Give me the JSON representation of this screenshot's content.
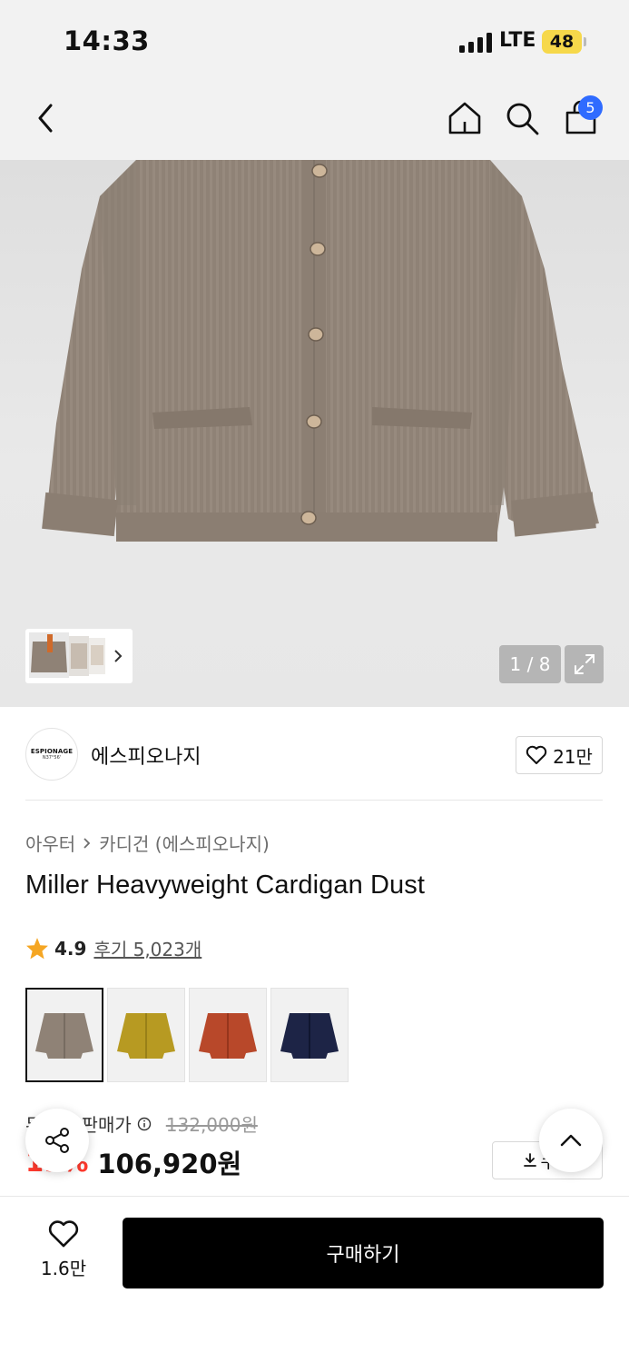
{
  "status": {
    "time": "14:33",
    "network": "LTE",
    "battery": "48"
  },
  "nav": {
    "back_icon": "back-arrow-icon",
    "home_icon": "home-icon",
    "search_icon": "search-icon",
    "cart_icon": "shopping-bag-icon",
    "cart_count": "5"
  },
  "gallery": {
    "counter": "1 / 8",
    "expand_icon": "expand-icon",
    "thumbs_more_icon": "chevron-right-icon"
  },
  "brand": {
    "logo_line1": "ESPIONAGE",
    "logo_line2": "N37°56'",
    "name": "에스피오나지",
    "likes": "21만"
  },
  "breadcrumb": {
    "category": "아우터",
    "subcategory": "카디건 (에스피오나지)"
  },
  "product": {
    "title": "Miller Heavyweight Cardigan Dust",
    "rating": "4.9",
    "reviews": "후기 5,023개",
    "swatches": [
      {
        "color": "#8f8276",
        "label": "Dust"
      },
      {
        "color": "#b79a22",
        "label": "Mustard"
      },
      {
        "color": "#b8482a",
        "label": "Rust"
      },
      {
        "color": "#1d2446",
        "label": "Navy"
      }
    ]
  },
  "price": {
    "label": "무신사 판매가",
    "original": "132,000원",
    "sale_rate": "19%",
    "sale_price": "106,920원",
    "coupon_label": "쿠폰"
  },
  "bottom": {
    "wish_count": "1.6만",
    "buy_label": "구매하기"
  },
  "colors": {
    "accent_red": "#ff3a2e",
    "badge_blue": "#2f6bff",
    "battery_yellow": "#f6d84a"
  }
}
